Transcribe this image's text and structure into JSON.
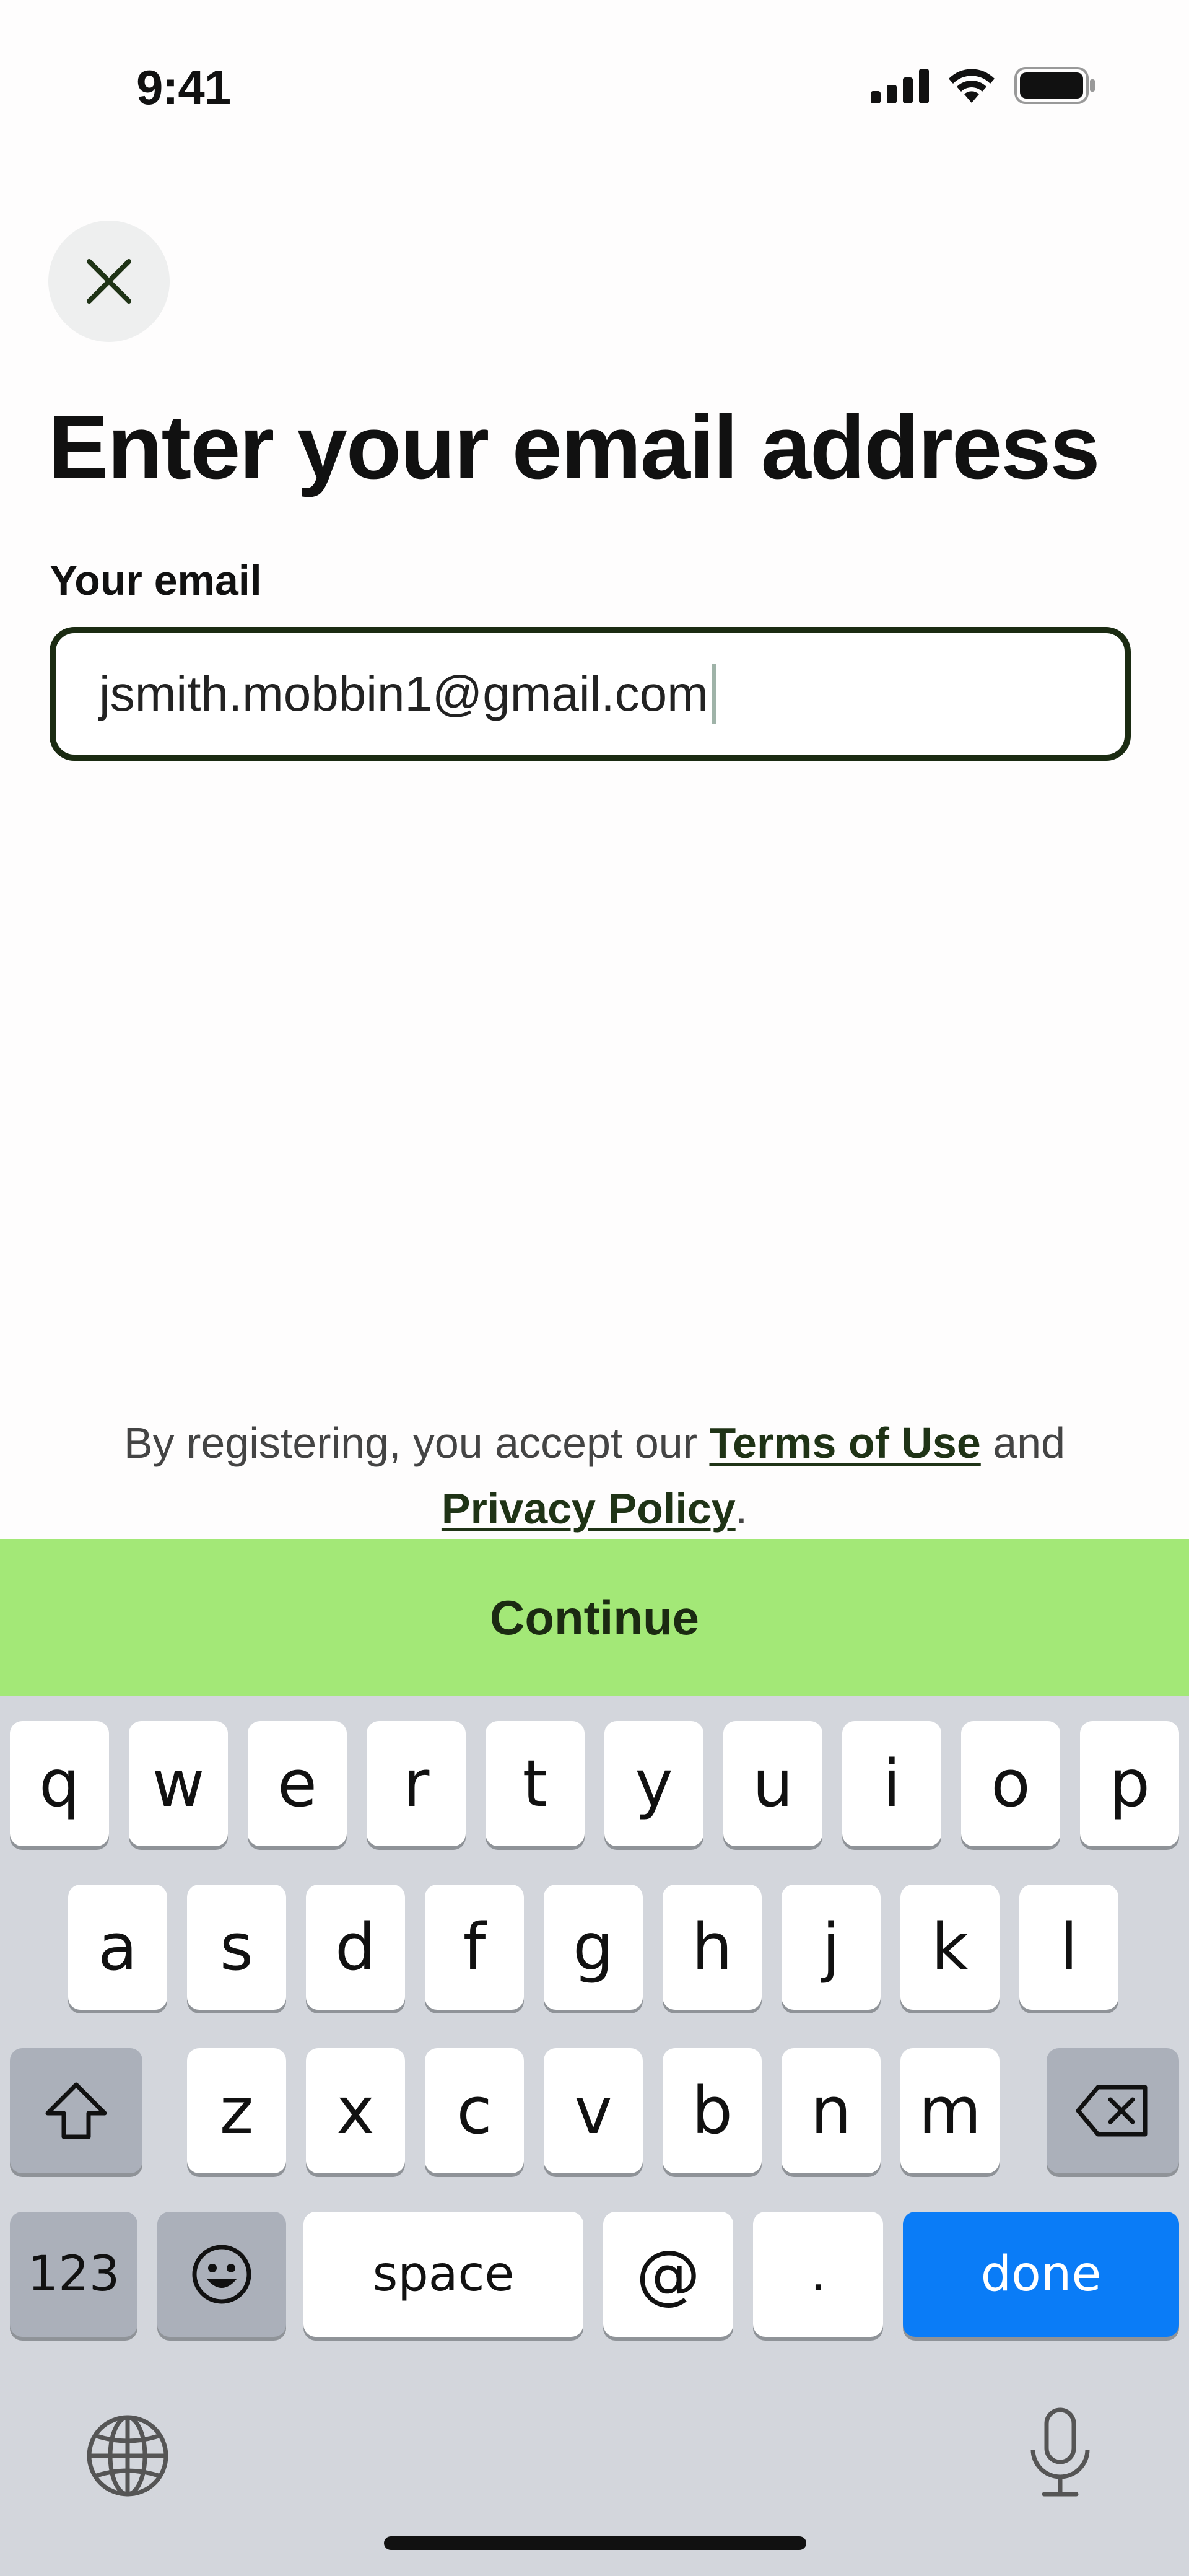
{
  "status_bar": {
    "time": "9:41"
  },
  "header": {
    "title": "Enter your email address"
  },
  "form": {
    "email_label": "Your email",
    "email_value": "jsmith.mobbin1@gmail.com"
  },
  "legal": {
    "prefix": "By registering, you accept our ",
    "terms_link": "Terms of Use",
    "middle": " and",
    "privacy_link": "Privacy Policy",
    "suffix": "."
  },
  "continue_button": {
    "label": "Continue",
    "color": "#a3e877"
  },
  "keyboard": {
    "row1": [
      "q",
      "w",
      "e",
      "r",
      "t",
      "y",
      "u",
      "i",
      "o",
      "p"
    ],
    "row2": [
      "a",
      "s",
      "d",
      "f",
      "g",
      "h",
      "j",
      "k",
      "l"
    ],
    "row3": [
      "z",
      "x",
      "c",
      "v",
      "b",
      "n",
      "m"
    ],
    "numbers_key": "123",
    "space_key": "space",
    "at_key": "@",
    "dot_key": ".",
    "done_key": "done",
    "done_color": "#0a7cf7",
    "icons": [
      "shift-icon",
      "backspace-icon",
      "emoji-icon",
      "globe-icon",
      "microphone-icon"
    ]
  }
}
